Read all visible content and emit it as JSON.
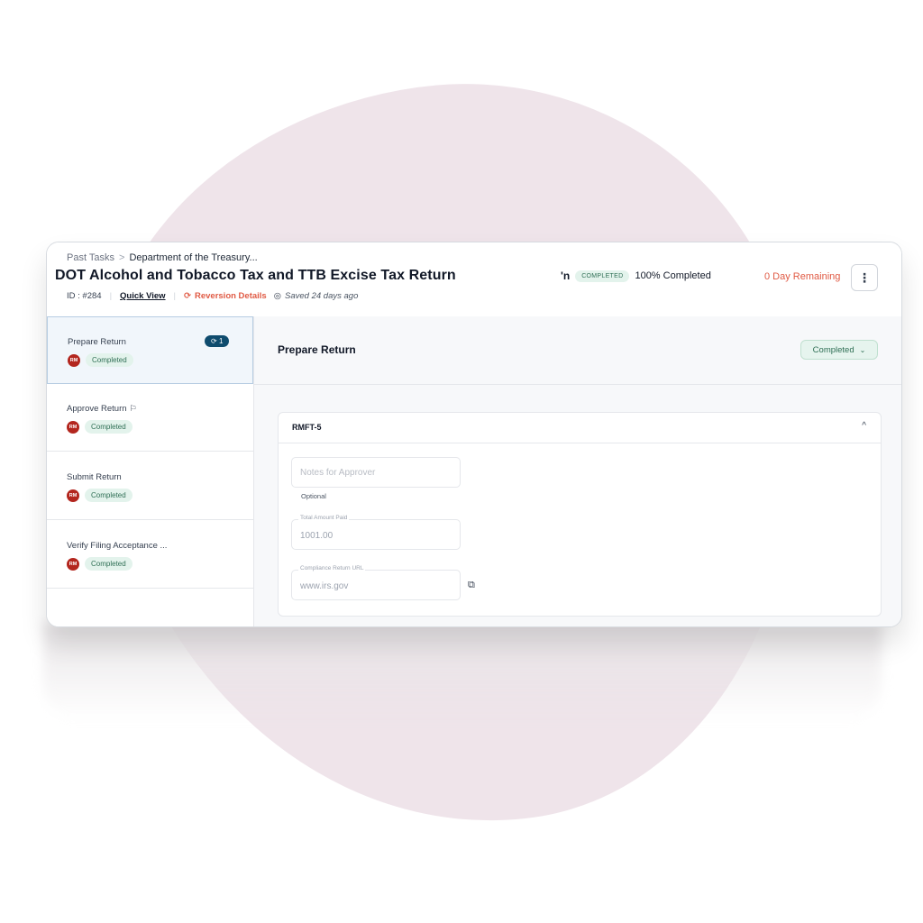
{
  "breadcrumb": {
    "parent": "Past Tasks",
    "current": "Department of the Treasury..."
  },
  "header": {
    "title": "DOT Alcohol and Tobacco Tax and TTB Excise Tax Return",
    "id_text": "ID : #284",
    "quick_view": "Quick View",
    "reversion": "Reversion Details",
    "saved": "Saved 24 days ago",
    "truncated_label": "'n",
    "status_pill": "COMPLETED",
    "progress_text": "100% Completed",
    "remaining": "0 Day Remaining"
  },
  "icons": {
    "reversion": "refresh-icon",
    "saved": "check-circle-icon",
    "kebab": "more-vertical-icon",
    "flag": "flag-icon",
    "external": "external-link-icon"
  },
  "colors": {
    "accent_red": "#e05a44",
    "badge_green_bg": "#e3f3ec",
    "badge_green_text": "#2f6f55",
    "avatar": "#b3261e",
    "count_badge": "#0f4c6e"
  },
  "steps": [
    {
      "title": "Prepare Return",
      "avatar": "RM",
      "status": "Completed",
      "count": "1"
    },
    {
      "title": "Approve Return",
      "avatar": "RM",
      "status": "Completed"
    },
    {
      "title": "Submit Return",
      "avatar": "RM",
      "status": "Completed"
    },
    {
      "title": "Verify Filing Acceptance ...",
      "avatar": "RM",
      "status": "Completed"
    }
  ],
  "main": {
    "title": "Prepare Return",
    "status_button": "Completed",
    "section_title": "RMFT-5",
    "notes_placeholder": "Notes for Approver",
    "notes_hint": "Optional",
    "total_label": "Total Amount Paid",
    "total_value": "1001.00",
    "url_label": "Compliance Return URL",
    "url_value": "www.irs.gov"
  }
}
